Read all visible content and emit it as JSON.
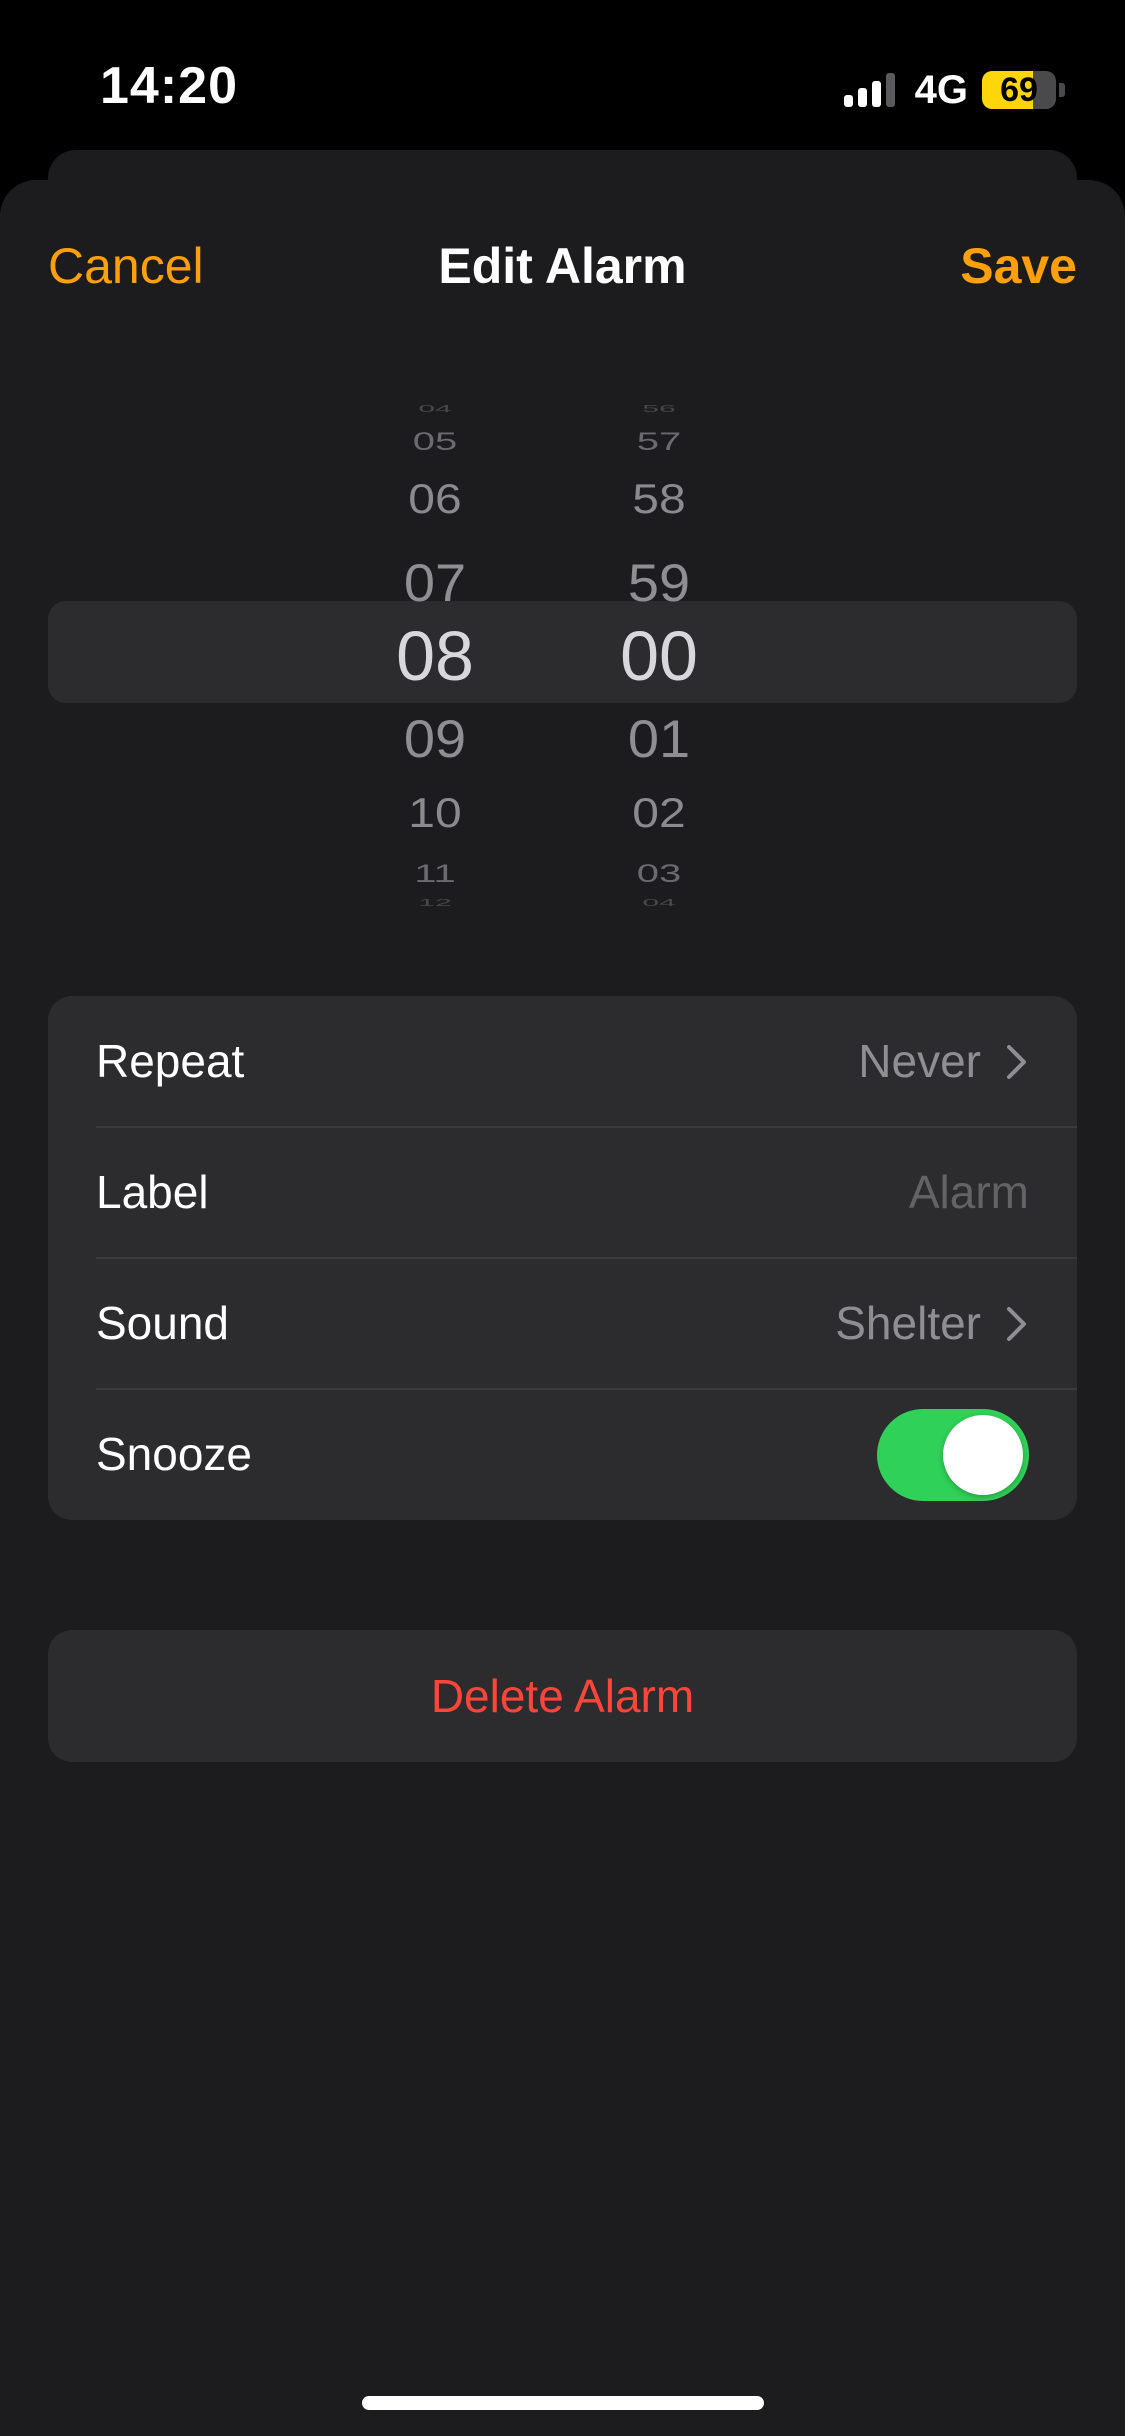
{
  "status_bar": {
    "time": "14:20",
    "network": "4G",
    "battery": "69",
    "battery_fill_percent": 69,
    "signal_bars_active": 3,
    "signal_bars_total": 4,
    "battery_color": "#ffd60a"
  },
  "nav": {
    "cancel_label": "Cancel",
    "title": "Edit Alarm",
    "save_label": "Save",
    "accent_color": "#ff9f0a"
  },
  "picker": {
    "hours": {
      "far_above_2": "04",
      "far_above": "05",
      "above_2": "06",
      "above": "07",
      "selected": "08",
      "below": "09",
      "below_2": "10",
      "far_below": "11",
      "far_below_2": "12"
    },
    "minutes": {
      "far_above_2": "56",
      "far_above": "57",
      "above_2": "58",
      "above": "59",
      "selected": "00",
      "below": "01",
      "below_2": "02",
      "far_below": "03",
      "far_below_2": "04"
    }
  },
  "settings": {
    "repeat": {
      "label": "Repeat",
      "value": "Never"
    },
    "label": {
      "label": "Label",
      "placeholder": "Alarm",
      "value": ""
    },
    "sound": {
      "label": "Sound",
      "value": "Shelter"
    },
    "snooze": {
      "label": "Snooze",
      "enabled": true,
      "on_color": "#30d158"
    }
  },
  "delete": {
    "label": "Delete Alarm",
    "color": "#ff453a"
  },
  "icons": {
    "chevron": "chevron-right-icon",
    "signal": "cellular-signal-icon",
    "battery": "battery-icon"
  }
}
